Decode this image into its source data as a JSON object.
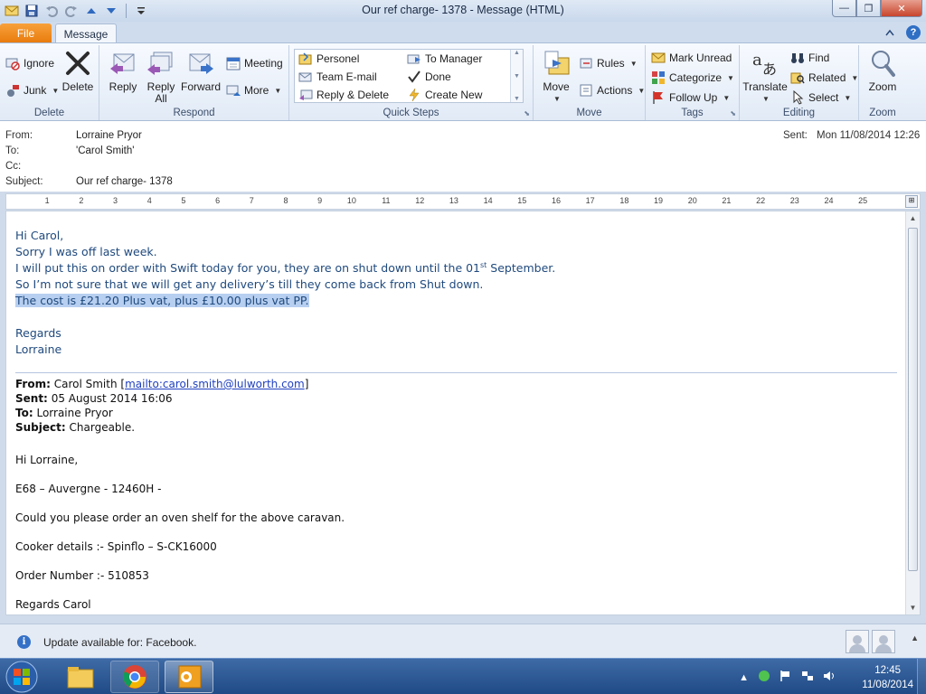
{
  "window": {
    "title": "Our ref charge- 1378  -  Message (HTML)",
    "minimize_glyph": "—",
    "restore_glyph": "❐",
    "close_glyph": "✕"
  },
  "tabs": {
    "file": "File",
    "message": "Message"
  },
  "ribbon": {
    "delete_group": {
      "label": "Delete",
      "ignore": "Ignore",
      "junk": "Junk",
      "delete": "Delete"
    },
    "respond_group": {
      "label": "Respond",
      "reply": "Reply",
      "reply_all_1": "Reply",
      "reply_all_2": "All",
      "forward": "Forward",
      "meeting": "Meeting",
      "more": "More"
    },
    "quick_steps": {
      "label": "Quick Steps",
      "items": [
        "Personel",
        "To Manager",
        "Team E-mail",
        "Done",
        "Reply & Delete",
        "Create New"
      ]
    },
    "move_group": {
      "label": "Move",
      "move": "Move",
      "rules": "Rules",
      "actions": "Actions"
    },
    "tags_group": {
      "label": "Tags",
      "mark_unread": "Mark Unread",
      "categorize": "Categorize",
      "follow_up": "Follow Up"
    },
    "editing_group": {
      "label": "Editing",
      "translate": "Translate",
      "find": "Find",
      "related": "Related",
      "select": "Select"
    },
    "zoom_group": {
      "label": "Zoom",
      "zoom": "Zoom"
    }
  },
  "headers": {
    "from_label": "From:",
    "from_value": "Lorraine Pryor",
    "to_label": "To:",
    "to_value": "'Carol Smith'",
    "cc_label": "Cc:",
    "subject_label": "Subject:",
    "subject_value": "Our ref charge- 1378",
    "sent_label": "Sent:",
    "sent_value": "Mon 11/08/2014 12:26"
  },
  "ruler": {
    "numbers": [
      "1",
      "2",
      "3",
      "4",
      "5",
      "6",
      "7",
      "8",
      "9",
      "10",
      "11",
      "12",
      "13",
      "14",
      "15",
      "16",
      "17",
      "18",
      "19",
      "20",
      "21",
      "22",
      "23",
      "24",
      "25"
    ]
  },
  "reply": {
    "greeting": "Hi Carol,",
    "line1": "Sorry I was off last week.",
    "line2_pre": "I will put this on order with Swift today for you, they are on shut down until the 01",
    "line2_sup": "st",
    "line2_post": " September.",
    "line3": "So I’m not sure that we will get any delivery’s till they come back from Shut down.",
    "line4": "The cost is £21.20 Plus vat, plus £10.00 plus vat PP. ",
    "regards": "Regards",
    "signature": "Lorraine"
  },
  "original": {
    "from_label": "From:",
    "from_name": "Carol Smith",
    "from_link": "mailto:carol.smith@lulworth.com",
    "sent_label": "Sent:",
    "sent_value": "05 August 2014 16:06",
    "to_label": "To:",
    "to_value": "Lorraine Pryor",
    "subject_label": "Subject:",
    "subject_value": "Chargeable.",
    "greeting": "Hi Lorraine,",
    "ref_line": "E68 – Auvergne -  12460H  -",
    "request": "Could you please order an oven shelf for the above caravan.",
    "cooker": "Cooker details  :-  Spinflo – S-CK16000",
    "order": "Order Number :-  510853",
    "sign_off": "Regards Carol"
  },
  "infobar": {
    "text": "Update available for: Facebook."
  },
  "taskbar": {
    "time": "12:45",
    "date": "11/08/2014"
  }
}
